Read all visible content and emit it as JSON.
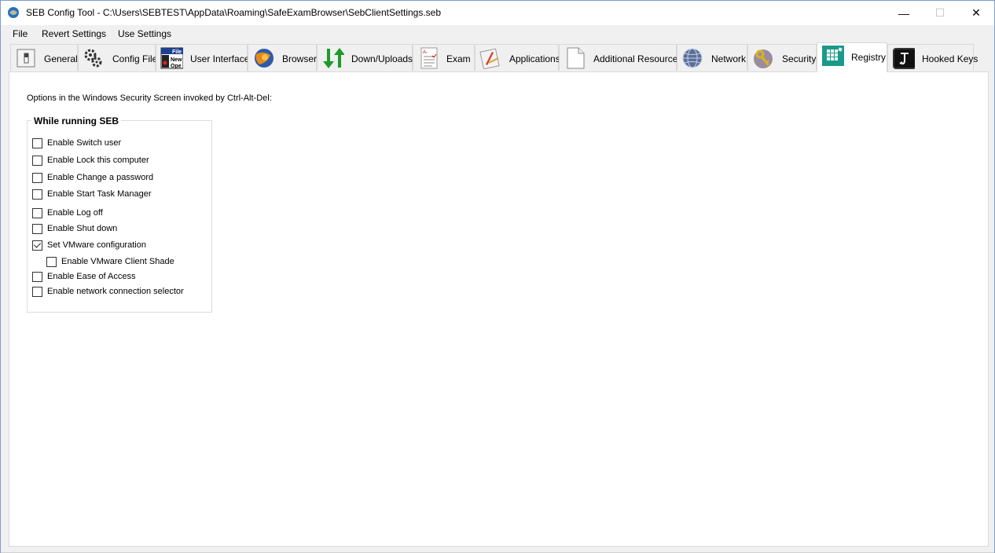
{
  "window": {
    "title": "SEB Config Tool - C:\\Users\\SEBTEST\\AppData\\Roaming\\SafeExamBrowser\\SebClientSettings.seb",
    "minimize_glyph": "—",
    "maximize_glyph": "☐",
    "close_glyph": "✕"
  },
  "menu": {
    "items": [
      "File",
      "Revert Settings",
      "Use Settings"
    ]
  },
  "tabs": [
    {
      "label": "General",
      "icon": "switch-icon"
    },
    {
      "label": "Config File",
      "icon": "gears-icon"
    },
    {
      "label": "User Interface",
      "icon": "menu-window-icon"
    },
    {
      "label": "Browser",
      "icon": "browser-globe-icon"
    },
    {
      "label": "Down/Uploads",
      "icon": "arrows-updown-icon"
    },
    {
      "label": "Exam",
      "icon": "exam-sheet-icon"
    },
    {
      "label": "Applications",
      "icon": "applications-icon"
    },
    {
      "label": "Additional Resources",
      "icon": "document-icon"
    },
    {
      "label": "Network",
      "icon": "network-globe-icon"
    },
    {
      "label": "Security",
      "icon": "keys-icon"
    },
    {
      "label": "Registry",
      "icon": "registry-icon",
      "active": true
    },
    {
      "label": "Hooked Keys",
      "icon": "hooked-keys-icon"
    }
  ],
  "registry": {
    "description": "Options in the Windows Security Screen invoked by Ctrl-Alt-Del:",
    "group_title": "While running SEB",
    "options": [
      {
        "label": "Enable Switch user",
        "checked": false
      },
      {
        "label": "Enable Lock this computer",
        "checked": false
      },
      {
        "label": "Enable Change a password",
        "checked": false
      },
      {
        "label": "Enable Start Task Manager",
        "checked": false
      },
      {
        "label": "Enable Log off",
        "checked": false
      },
      {
        "label": "Enable Shut down",
        "checked": false
      },
      {
        "label": "Set VMware configuration",
        "checked": true
      },
      {
        "label": "Enable VMware Client Shade",
        "checked": false
      },
      {
        "label": "Enable Ease of Access",
        "checked": false
      },
      {
        "label": "Enable network connection selector",
        "checked": false
      }
    ]
  },
  "colors": {
    "window_border": "#7a9ccf",
    "panel_bg": "#ffffff",
    "chrome_bg": "#f0f0f0",
    "registry_teal": "#1a9a8a"
  }
}
